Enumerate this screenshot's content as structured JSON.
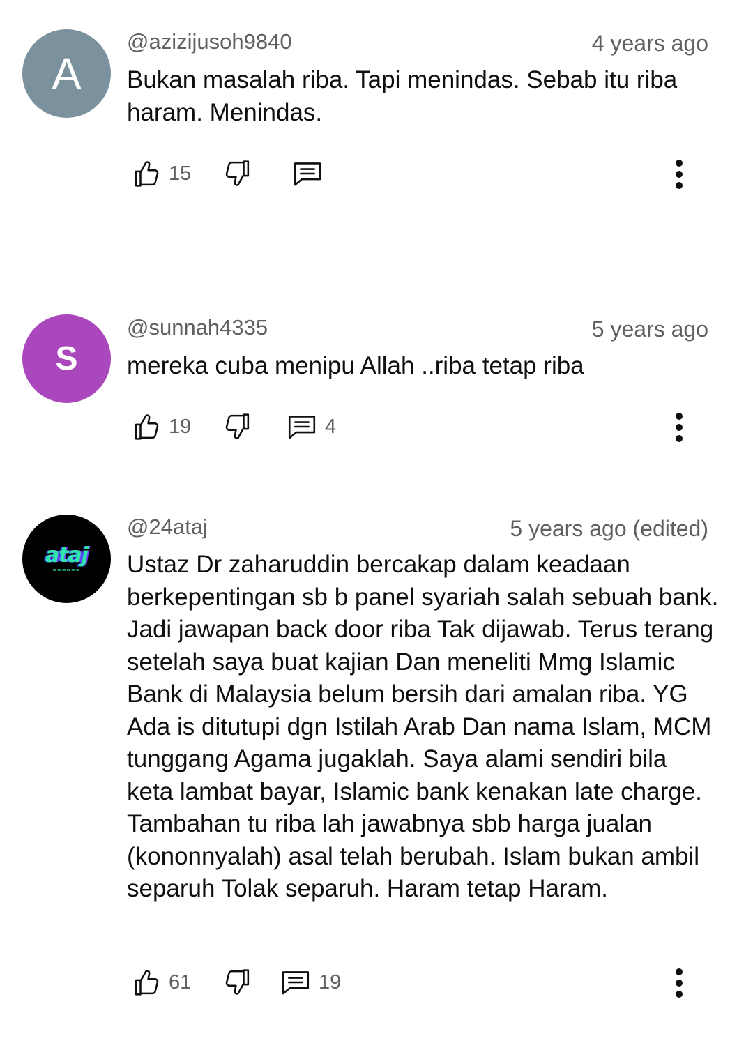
{
  "comments": [
    {
      "avatar_letter": "A",
      "avatar_color": "#7b919e",
      "handle": "@azizijusoh9840",
      "time": "4 years ago",
      "body": "Bukan masalah riba. Tapi menindas. Sebab itu riba haram. Menindas.",
      "likes": "15",
      "replies": ""
    },
    {
      "avatar_letter": "S",
      "avatar_color": "#ab47bc",
      "handle": "@sunnah4335",
      "time": "5 years ago",
      "body": "mereka cuba menipu Allah ..riba tetap riba",
      "likes": "19",
      "replies": "4"
    },
    {
      "avatar_logo_text": "ataj",
      "avatar_color": "#000000",
      "handle": "@24ataj",
      "time": "5 years ago (edited)",
      "body": "Ustaz Dr zaharuddin bercakap dalam keadaan berkepentingan sb b panel syariah salah sebuah bank. Jadi jawapan back door riba Tak dijawab. Terus terang setelah saya buat kajian Dan meneliti Mmg Islamic Bank di Malaysia belum bersih dari amalan riba. YG Ada is ditutupi dgn Istilah Arab Dan nama Islam, MCM tunggang Agama jugaklah. Saya alami sendiri bila keta lambat bayar, Islamic bank kenakan late charge. Tambahan tu riba lah jawabnya sbb harga jualan (kononnyalah) asal telah berubah. Islam bukan ambil separuh Tolak separuh. Haram tetap Haram.",
      "likes": "61",
      "replies": "19"
    }
  ],
  "icons": {
    "like": "thumbs-up-outline-icon",
    "dislike": "thumbs-down-outline-icon",
    "reply": "comment-bubble-icon",
    "more": "more-vertical-icon"
  },
  "colors": {
    "text": "#0f0f0f",
    "secondary": "#606060",
    "icon": "#0f0f0f"
  }
}
